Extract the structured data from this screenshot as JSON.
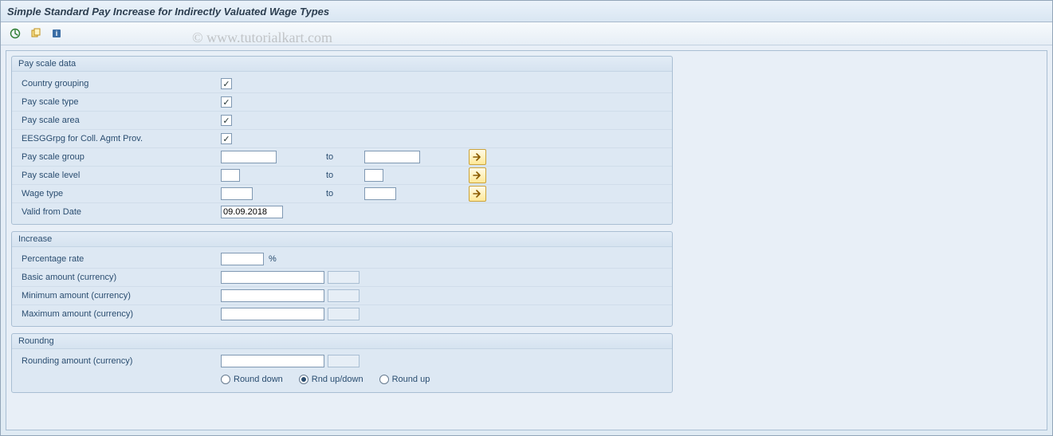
{
  "title": "Simple Standard Pay Increase for Indirectly Valuated Wage Types",
  "watermark": "© www.tutorialkart.com",
  "toolbar": {
    "execute_icon": "execute-icon",
    "variant_icon": "variant-icon",
    "info_icon": "info-icon"
  },
  "groups": {
    "pay_scale": {
      "title": "Pay scale data",
      "fields": {
        "country_grouping": {
          "label": "Country grouping",
          "checked": true
        },
        "pay_scale_type": {
          "label": "Pay scale type",
          "checked": true
        },
        "pay_scale_area": {
          "label": "Pay scale area",
          "checked": true
        },
        "eesggrpg": {
          "label": "EESGGrpg for Coll. Agmt Prov.",
          "checked": true
        },
        "pay_scale_group": {
          "label": "Pay scale group",
          "from": "",
          "to_label": "to",
          "to": ""
        },
        "pay_scale_level": {
          "label": "Pay scale level",
          "from": "",
          "to_label": "to",
          "to": ""
        },
        "wage_type": {
          "label": "Wage type",
          "from": "",
          "to_label": "to",
          "to": ""
        },
        "valid_from": {
          "label": "Valid from Date",
          "value": "09.09.2018"
        }
      }
    },
    "increase": {
      "title": "Increase",
      "fields": {
        "percentage_rate": {
          "label": "Percentage rate",
          "value": "",
          "suffix": "%"
        },
        "basic_amount": {
          "label": "Basic amount (currency)",
          "amount": "",
          "currency": ""
        },
        "minimum_amount": {
          "label": "Minimum amount (currency)",
          "amount": "",
          "currency": ""
        },
        "maximum_amount": {
          "label": "Maximum amount (currency)",
          "amount": "",
          "currency": ""
        }
      }
    },
    "rounding": {
      "title": "Roundng",
      "fields": {
        "rounding_amount": {
          "label": "Rounding amount (currency)",
          "amount": "",
          "currency": ""
        },
        "options": {
          "round_down": {
            "label": "Round down",
            "selected": false
          },
          "rnd_up_down": {
            "label": "Rnd up/down",
            "selected": true
          },
          "round_up": {
            "label": "Round up",
            "selected": false
          }
        }
      }
    }
  }
}
